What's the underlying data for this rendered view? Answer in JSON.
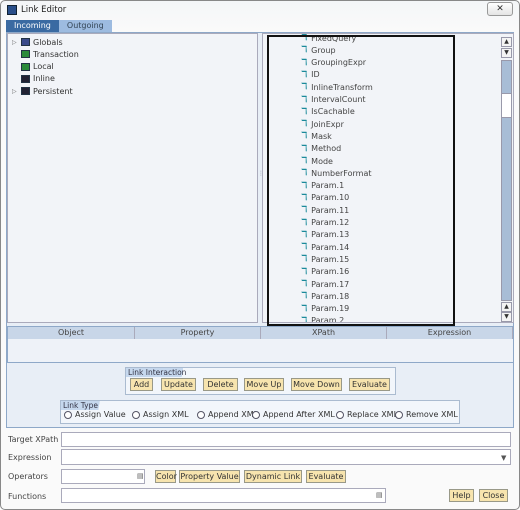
{
  "window": {
    "title": "Link Editor",
    "close_icon": "close-icon"
  },
  "tabs": [
    {
      "label": "Incoming",
      "active": true
    },
    {
      "label": "Outgoing",
      "active": false
    }
  ],
  "tree": [
    {
      "label": "Globals",
      "expandable": true,
      "icon": "folder-icon",
      "color": "#3a4a8a"
    },
    {
      "label": "Transaction",
      "expandable": false,
      "icon": "folder-icon",
      "color": "#2a8a3a"
    },
    {
      "label": "Local",
      "expandable": false,
      "icon": "folder-icon",
      "color": "#2a8a3a"
    },
    {
      "label": "Inline",
      "expandable": false,
      "icon": "inline-icon",
      "color": "#223"
    },
    {
      "label": "Persistent",
      "expandable": true,
      "icon": "persistent-icon",
      "color": "#223"
    }
  ],
  "properties": [
    "FixedQuery",
    "Group",
    "GroupingExpr",
    "ID",
    "InlineTransform",
    "IntervalCount",
    "IsCachable",
    "JoinExpr",
    "Mask",
    "Method",
    "Mode",
    "NumberFormat",
    "Param.1",
    "Param.10",
    "Param.11",
    "Param.12",
    "Param.13",
    "Param.14",
    "Param.15",
    "Param.16",
    "Param.17",
    "Param.18",
    "Param.19",
    "Param.2"
  ],
  "table": {
    "columns": [
      "Object",
      "Property",
      "XPath",
      "Expression"
    ]
  },
  "link_interaction": {
    "label": "Link Interaction",
    "buttons": [
      "Add",
      "Update",
      "Delete",
      "Move Up",
      "Move Down",
      "Evaluate"
    ]
  },
  "link_type": {
    "label": "Link Type",
    "options": [
      "Assign Value",
      "Assign XML",
      "Append XML",
      "Append After XML",
      "Replace XML",
      "Remove XML"
    ],
    "selected": null
  },
  "form": {
    "target_xpath": {
      "label": "Target XPath",
      "value": ""
    },
    "expression": {
      "label": "Expression",
      "value": ""
    },
    "operators": {
      "label": "Operators",
      "value": ""
    },
    "functions": {
      "label": "Functions",
      "value": ""
    },
    "buttons": [
      "Color",
      "Property Value",
      "Dynamic Link",
      "Evaluate"
    ],
    "help": "Help",
    "close": "Close"
  },
  "colors": {
    "accent": "#3a6aa2",
    "button": "#f7e4ae"
  }
}
